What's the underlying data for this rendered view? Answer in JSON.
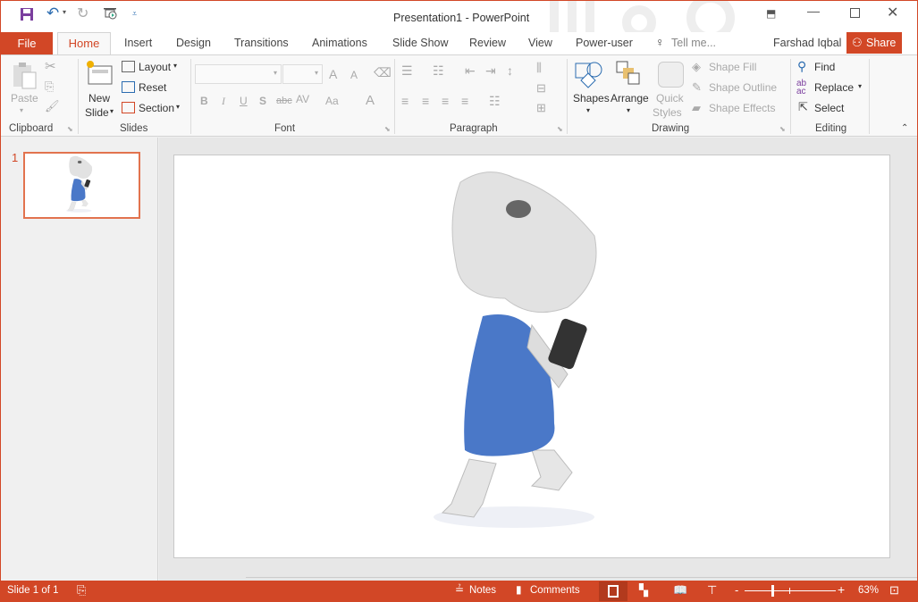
{
  "window": {
    "title": "Presentation1 - PowerPoint"
  },
  "quick_access": {
    "icons": [
      "save-icon",
      "undo-icon",
      "redo-icon",
      "start-from-beginning-icon",
      "customize-icon"
    ]
  },
  "tabs": {
    "file": "File",
    "home": "Home",
    "insert": "Insert",
    "design": "Design",
    "transitions": "Transitions",
    "animations": "Animations",
    "slide_show": "Slide Show",
    "review": "Review",
    "view": "View",
    "power_user": "Power-user",
    "tell_me": "Tell me...",
    "user": "Farshad Iqbal",
    "share": "Share"
  },
  "ribbon": {
    "clipboard": {
      "label": "Clipboard",
      "paste": "Paste"
    },
    "slides": {
      "label": "Slides",
      "new_slide_1": "New",
      "new_slide_2": "Slide",
      "layout": "Layout",
      "reset": "Reset",
      "section": "Section"
    },
    "font": {
      "label": "Font",
      "bold": "B",
      "italic": "I",
      "underline": "U",
      "shadow": "S",
      "strike": "abc",
      "spacing": "AV",
      "case": "Aa",
      "color": "A",
      "grow": "A",
      "shrink": "A"
    },
    "paragraph": {
      "label": "Paragraph"
    },
    "drawing": {
      "label": "Drawing",
      "shapes": "Shapes",
      "arrange": "Arrange",
      "quick_styles_1": "Quick",
      "quick_styles_2": "Styles",
      "shape_fill": "Shape Fill",
      "shape_outline": "Shape Outline",
      "shape_effects": "Shape Effects"
    },
    "editing": {
      "label": "Editing",
      "find": "Find",
      "replace": "Replace",
      "select": "Select"
    }
  },
  "slides_pane": {
    "items": [
      {
        "number": "1"
      }
    ]
  },
  "status": {
    "slide": "Slide 1 of 1",
    "notes": "Notes",
    "comments": "Comments",
    "zoom": "63%",
    "zoom_fraction": 0.3
  },
  "colors": {
    "accent": "#d24726",
    "dress": "#4a78c8"
  }
}
